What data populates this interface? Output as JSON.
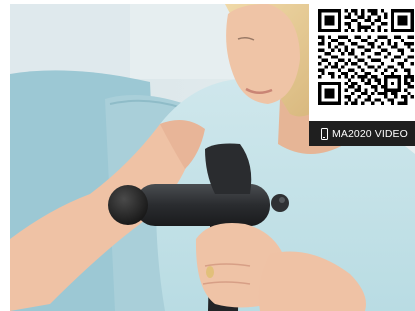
{
  "photo": {
    "subject": "woman-using-massage-gun-on-arm"
  },
  "qr_panel": {
    "icon": "phone-icon",
    "video_label": "MA2020 VIDEO"
  },
  "colors": {
    "video_bar_bg": "#1f1f1f",
    "video_bar_text": "#ffffff",
    "background": "#ffffff"
  }
}
